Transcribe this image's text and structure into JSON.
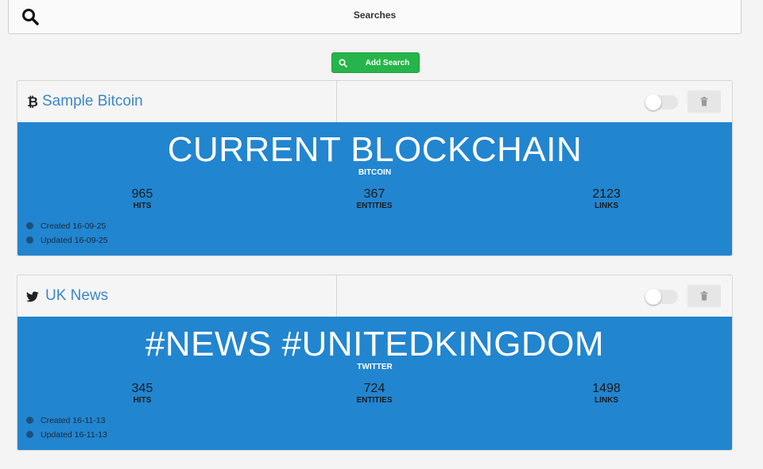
{
  "header": {
    "title": "Searches",
    "icon": "search-icon"
  },
  "add_button": {
    "label": "Add Search",
    "icon": "search-icon",
    "color": "#26b54a"
  },
  "accent_color": "#2285cf",
  "searches": [
    {
      "name": "Sample Bitcoin",
      "source_icon": "bitcoin-icon",
      "query": "CURRENT BLOCKCHAIN",
      "source": "BITCOIN",
      "stats": [
        {
          "value": "965",
          "label": "HITS"
        },
        {
          "value": "367",
          "label": "ENTITIES"
        },
        {
          "value": "2123",
          "label": "LINKS"
        }
      ],
      "created": "Created 16-09-25",
      "updated": "Updated 16-09-25",
      "enabled": false
    },
    {
      "name": "UK News",
      "source_icon": "twitter-icon",
      "query": "#NEWS #UNITEDKINGDOM",
      "source": "TWITTER",
      "stats": [
        {
          "value": "345",
          "label": "HITS"
        },
        {
          "value": "724",
          "label": "ENTITIES"
        },
        {
          "value": "1498",
          "label": "LINKS"
        }
      ],
      "created": "Created 16-11-13",
      "updated": "Updated 16-11-13",
      "enabled": false
    }
  ]
}
